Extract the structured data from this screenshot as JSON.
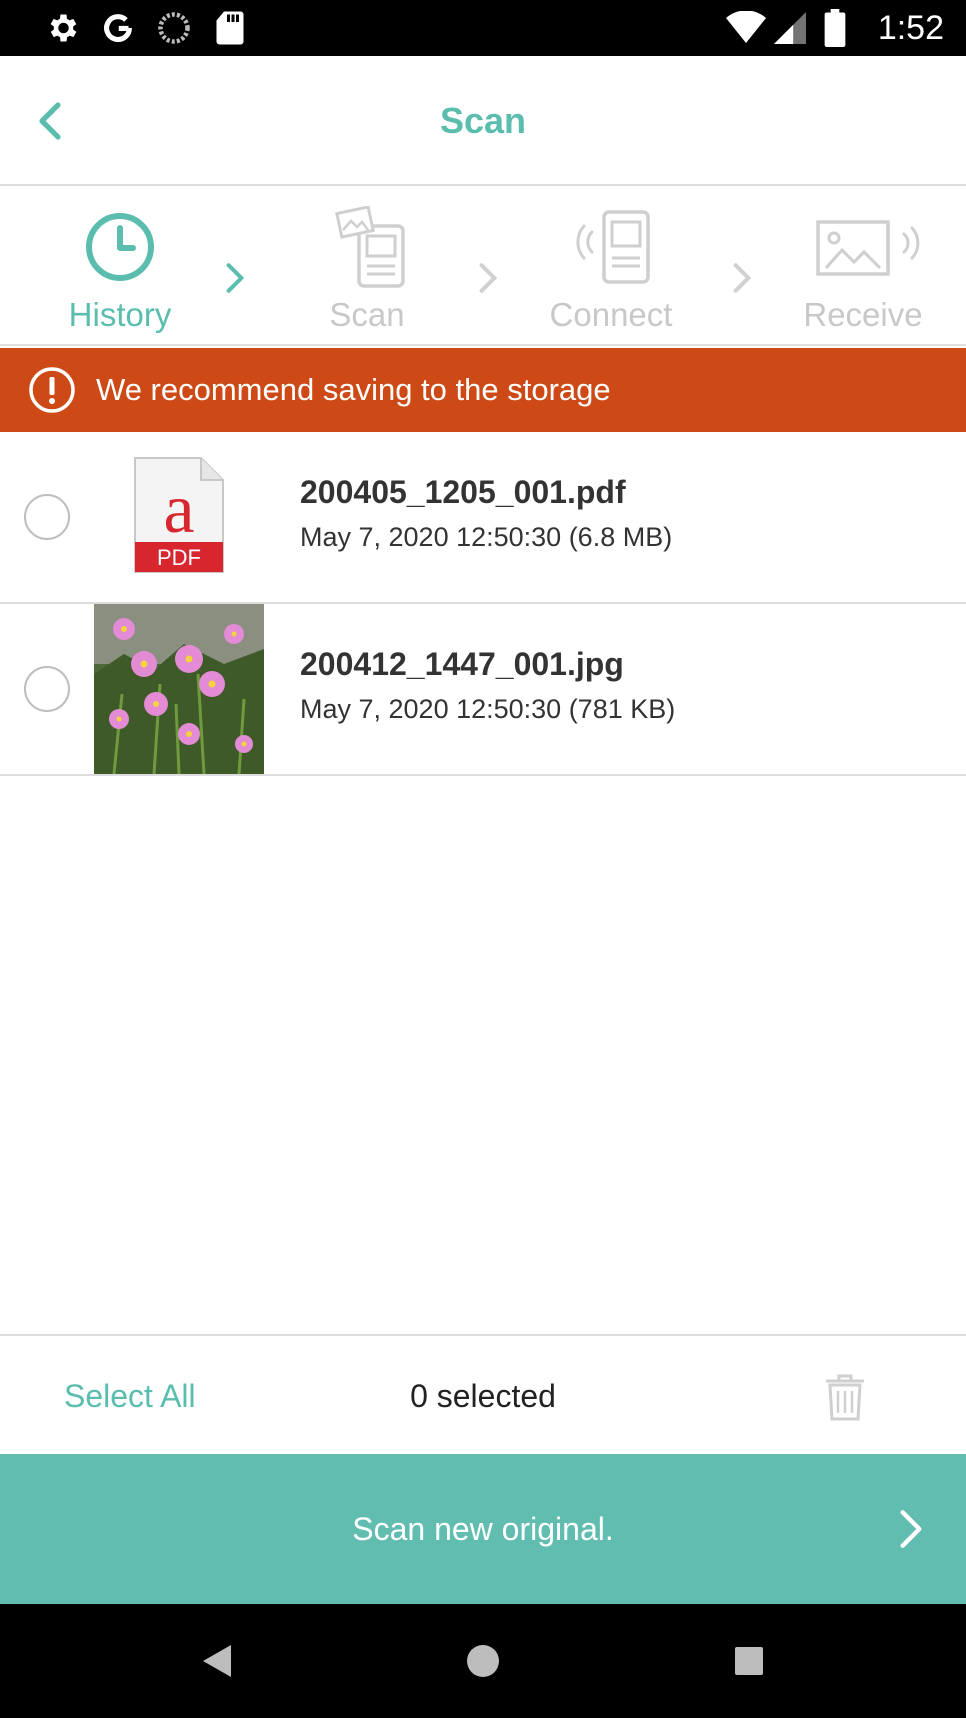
{
  "status_bar": {
    "time": "1:52",
    "icons": [
      "settings-icon",
      "google-icon",
      "sync-icon",
      "sd-card-icon",
      "wifi-icon",
      "signal-icon",
      "battery-icon"
    ]
  },
  "header": {
    "title": "Scan",
    "back_icon": "chevron-left-icon",
    "accent_color": "#5bbdae"
  },
  "steps": [
    {
      "label": "History",
      "icon": "clock-icon",
      "active": true
    },
    {
      "label": "Scan",
      "icon": "scanner-icon",
      "active": false
    },
    {
      "label": "Connect",
      "icon": "wireless-device-icon",
      "active": false
    },
    {
      "label": "Receive",
      "icon": "image-receive-icon",
      "active": false
    }
  ],
  "warning": {
    "text": "We recommend saving to the storage",
    "icon": "alert-circle-icon",
    "color": "#cd4a16"
  },
  "files": [
    {
      "name": "200405_1205_001.pdf",
      "meta": "May 7, 2020 12:50:30 (6.8 MB)",
      "thumb": "pdf-icon",
      "thumb_label": "PDF",
      "selected": false
    },
    {
      "name": "200412_1447_001.jpg",
      "meta": "May 7, 2020 12:50:30 (781 KB)",
      "thumb": "flower-photo",
      "selected": false
    }
  ],
  "actions": {
    "select_all": "Select All",
    "selected_count": "0 selected",
    "delete_icon": "trash-icon"
  },
  "scan_button": {
    "label": "Scan new original.",
    "color": "#62bdb1"
  },
  "nav": {
    "icons": [
      "back-triangle-icon",
      "home-circle-icon",
      "recents-square-icon"
    ]
  }
}
